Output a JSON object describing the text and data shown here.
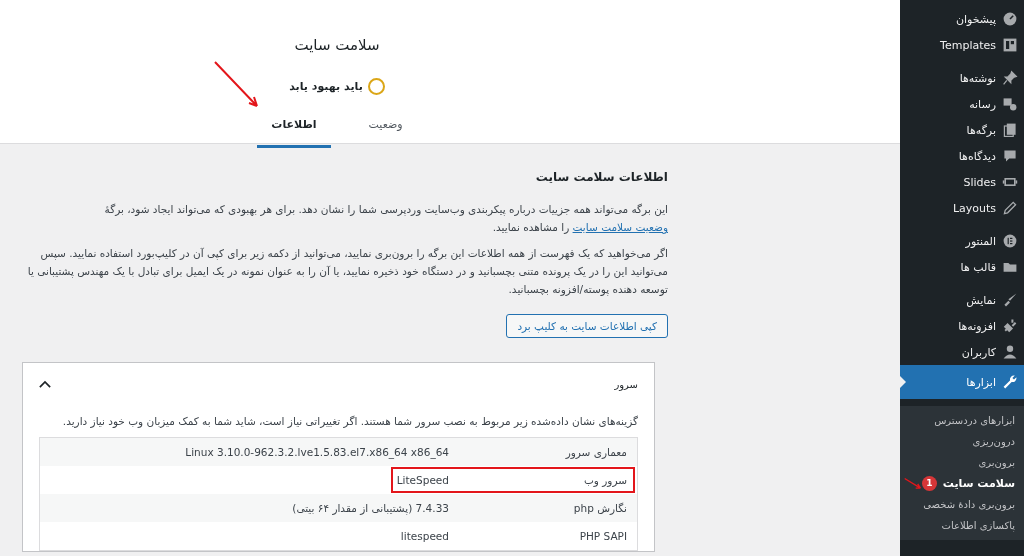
{
  "sidebar": {
    "groups": [
      [
        {
          "label": "پیشخوان",
          "selected": false
        },
        {
          "label": "Templates",
          "selected": false
        }
      ],
      [
        {
          "label": "نوشته‌ها",
          "selected": false
        },
        {
          "label": "رسانه",
          "selected": false
        },
        {
          "label": "برگه‌ها",
          "selected": false
        },
        {
          "label": "دیدگاه‌ها",
          "selected": false
        },
        {
          "label": "Slides",
          "selected": false
        },
        {
          "label": "Layouts",
          "selected": false
        }
      ],
      [
        {
          "label": "المنتور",
          "selected": false
        },
        {
          "label": "قالب ها",
          "selected": false
        }
      ],
      [
        {
          "label": "نمایش",
          "selected": false
        },
        {
          "label": "افزونه‌ها",
          "selected": false
        },
        {
          "label": "کاربران",
          "selected": false
        },
        {
          "label": "ابزارها",
          "selected": true
        }
      ]
    ],
    "submenu": [
      {
        "label": "ابزارهای دردسترس",
        "selected": false,
        "annotated": false
      },
      {
        "label": "درون‌ریزی",
        "selected": false,
        "annotated": false
      },
      {
        "label": "برون‌بری",
        "selected": false,
        "annotated": false
      },
      {
        "label": "سلامت سایت",
        "selected": true,
        "annotated": true,
        "badge": "1"
      },
      {
        "label": "برون‌بری دادهٔ شخصی",
        "selected": false,
        "annotated": false
      },
      {
        "label": "پاکسازی اطلاعات",
        "selected": false,
        "annotated": false
      }
    ]
  },
  "header": {
    "title": "سلامت سایت",
    "status": {
      "label": "باید بهبود یابد",
      "kind": "should-improve"
    },
    "tabs": [
      {
        "label": "وضعیت",
        "selected": false,
        "annotated": false
      },
      {
        "label": "اطلاعات",
        "selected": true,
        "annotated": true
      }
    ]
  },
  "content": {
    "heading": "اطلاعات سلامت سایت",
    "intro": {
      "before": "این برگه می‌تواند همه جزییات درباره پیکربندی وب‌سایت وردپرسی شما را نشان دهد. برای هر بهبودی که می‌تواند ایجاد شود، برگهٔ ",
      "link": "وضعیت سلامت سایت",
      "after": " را مشاهده نمایید."
    },
    "paragraph": "اگر می‌خواهید که یک فهرست از همه اطلاعات این برگه را برون‌بری نمایید، می‌توانید از دکمه زیر برای کپی آن در کلیپ‌بورد استفاده نمایید. سپس می‌توانید این را در یک پرونده متنی بچسبانید و در دستگاه خود ذخیره نمایید، یا آن را به عنوان نمونه در یک ایمیل برای تبادل با یک مهندس پشتیبانی یا توسعه دهنده پوسته/افزونه بچسبانید.",
    "copy_button": "کپی اطلاعات سایت به کلیپ برد",
    "section": {
      "title": "سرور",
      "expanded": true,
      "description": "گزینه‌های نشان داده‌شده زیر مربوط به نصب سرور شما هستند. اگر تغییراتی نیاز است، شاید شما به کمک میزبان وب خود نیاز دارید.",
      "rows": [
        {
          "label": "معماری سرور",
          "value": "Linux 3.10.0-962.3.2.lve1.5.83.el7.x86_64 x86_64",
          "highlighted": false
        },
        {
          "label": "سرور وب",
          "value": "LiteSpeed",
          "highlighted": true
        },
        {
          "label": "نگارش php",
          "value": "7.4.33 (پشتیبانی از مقدار ۶۴ بیتی)",
          "highlighted": false
        },
        {
          "label": "PHP SAPI",
          "value": "litespeed",
          "highlighted": false
        }
      ]
    }
  }
}
